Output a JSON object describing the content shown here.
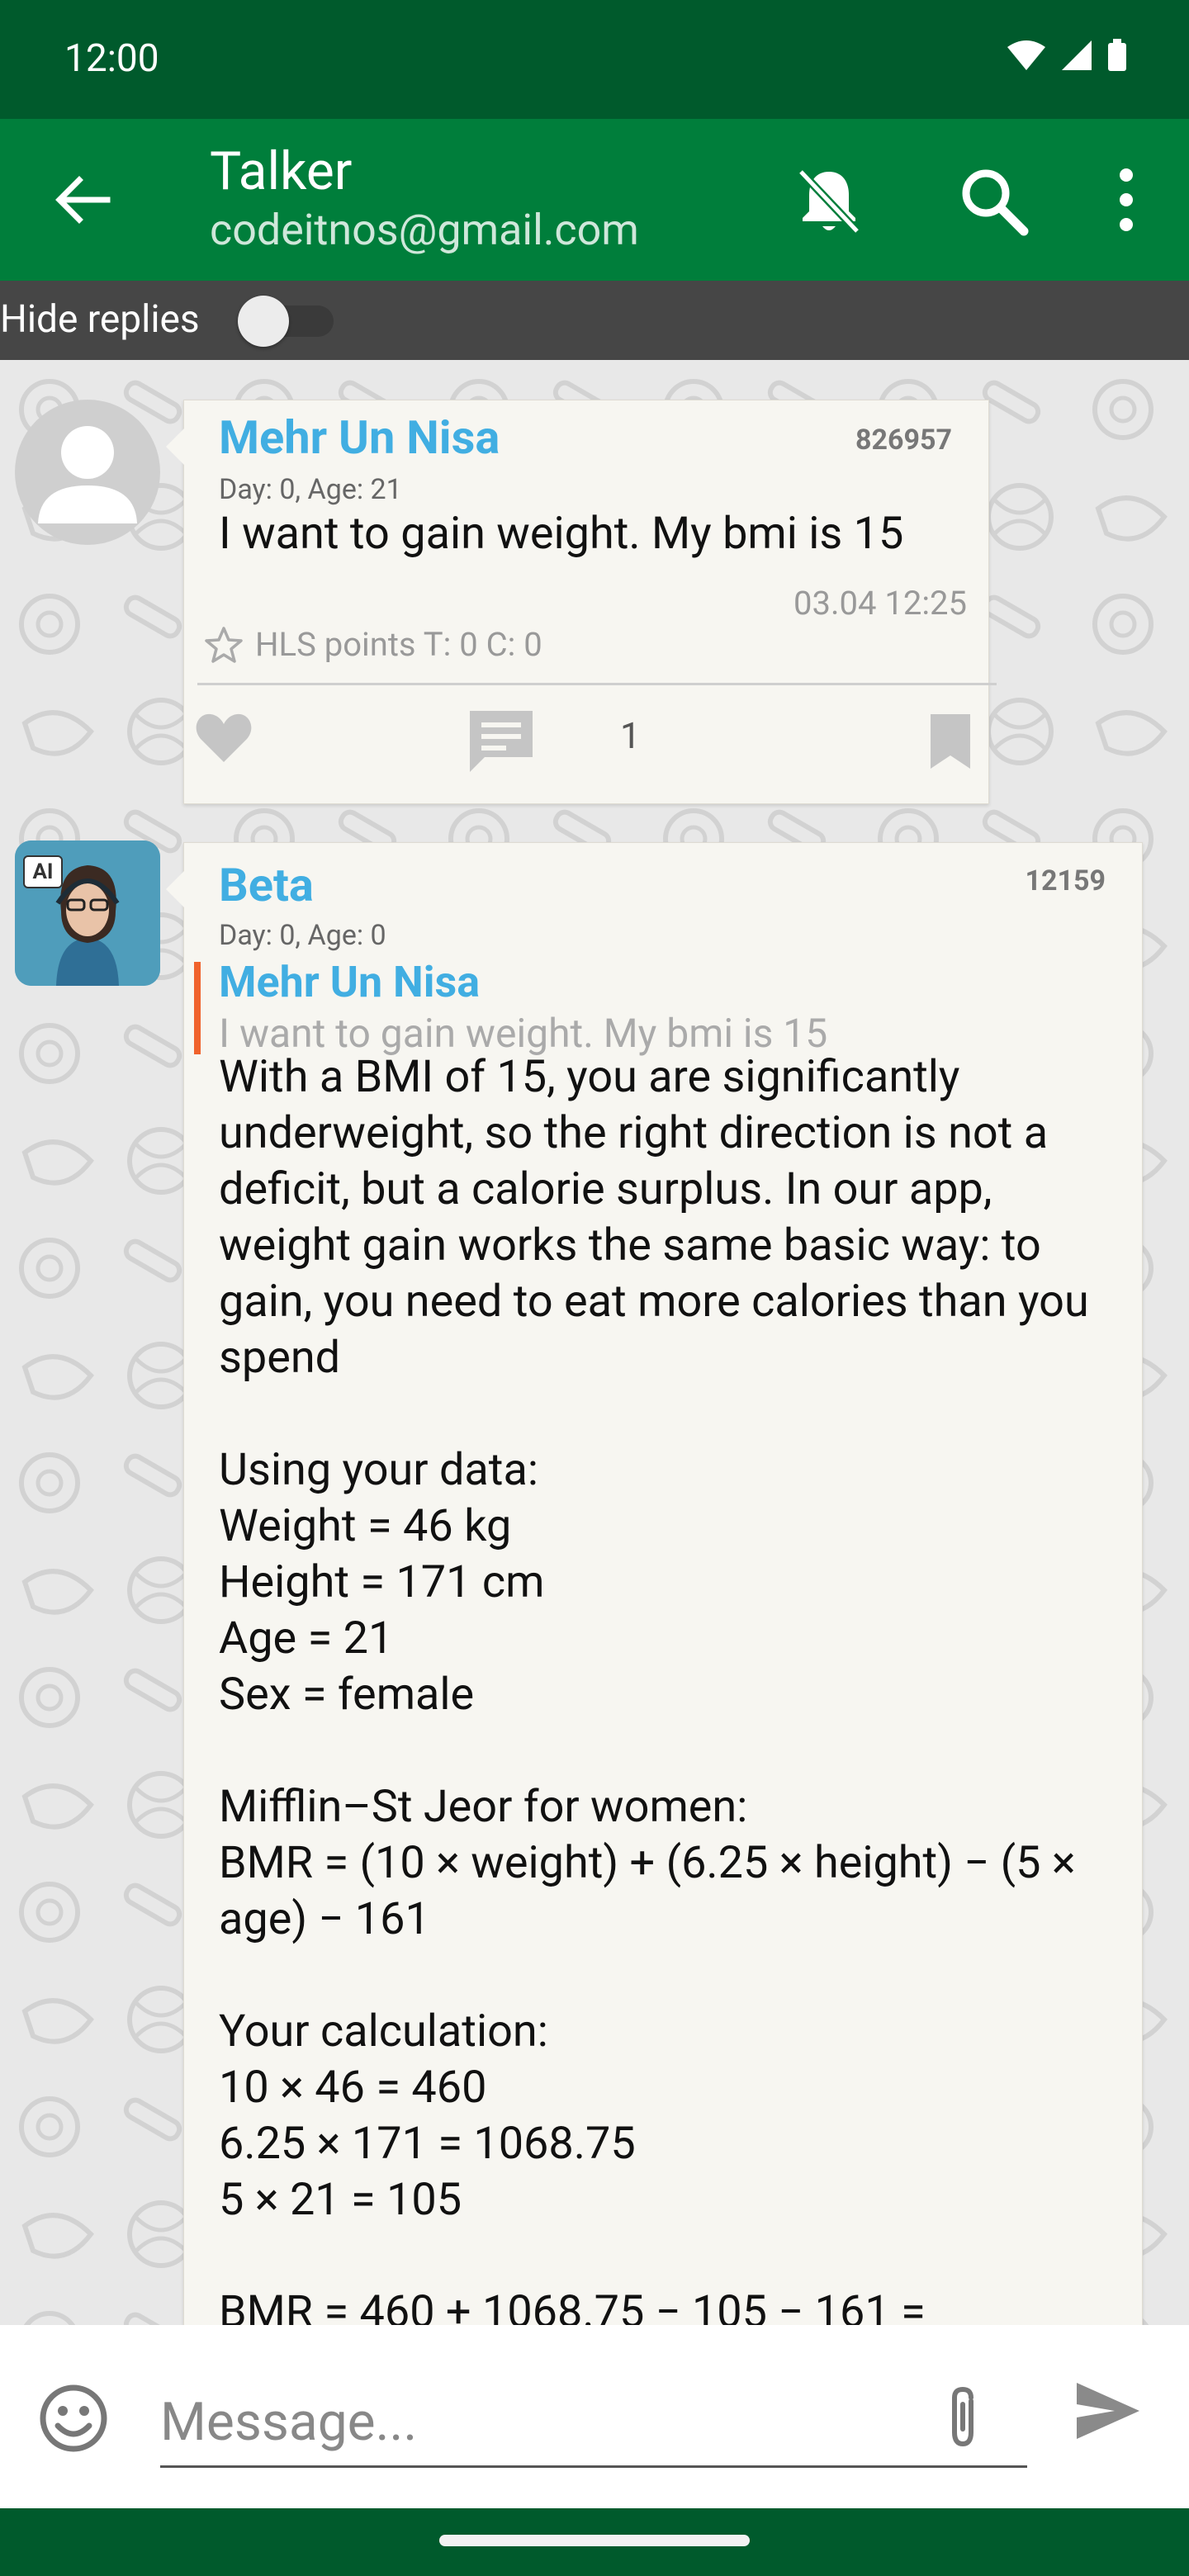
{
  "status": {
    "time": "12:00"
  },
  "appbar": {
    "title": "Talker",
    "subtitle": "codeitnos@gmail.com"
  },
  "filter": {
    "label": "Hide replies",
    "toggle_on": false
  },
  "messages": [
    {
      "author": "Mehr Un Nisa",
      "id": "826957",
      "meta": "Day: 0, Age: 21",
      "text": "I want to gain weight. My bmi is 15",
      "timestamp": "03.04 12:25",
      "hls": "HLS points T: 0 C: 0",
      "comments": "1"
    },
    {
      "author": "Beta",
      "id": "12159",
      "meta": "Day: 0, Age: 0",
      "quote_author": "Mehr Un Nisa",
      "quote_text": "I want to gain weight. My bmi is 15",
      "body": "With a BMI of 15, you are significantly underweight, so the right direction is not a deficit, but a calorie surplus. In our app, weight gain works the same basic way: to gain, you need to eat more calories than you spend\n\nUsing your data:\nWeight = 46 kg\nHeight = 171 cm\nAge = 21\nSex = female\n\nMifflin–St Jeor for women:\nBMR = (10 × weight) + (6.25 × height) − (5 × age) − 161\n\nYour calculation:\n10 × 46 = 460\n6.25 × 171 = 1068.75\n5 × 21 = 105\n\nBMR = 460 + 1068.75 − 105 − 161 =",
      "avatar_badge": "AI"
    }
  ],
  "composer": {
    "placeholder": "Message..."
  },
  "colors": {
    "status_bar": "#005a2c",
    "app_bar": "#007e3b",
    "author_name": "#41aee2",
    "quote_bar": "#f0622c"
  },
  "icons": [
    "back-arrow-icon",
    "notifications-off-icon",
    "search-icon",
    "more-vert-icon",
    "heart-icon",
    "comment-icon",
    "bookmark-icon",
    "star-icon",
    "emoji-icon",
    "attach-icon",
    "send-icon"
  ]
}
